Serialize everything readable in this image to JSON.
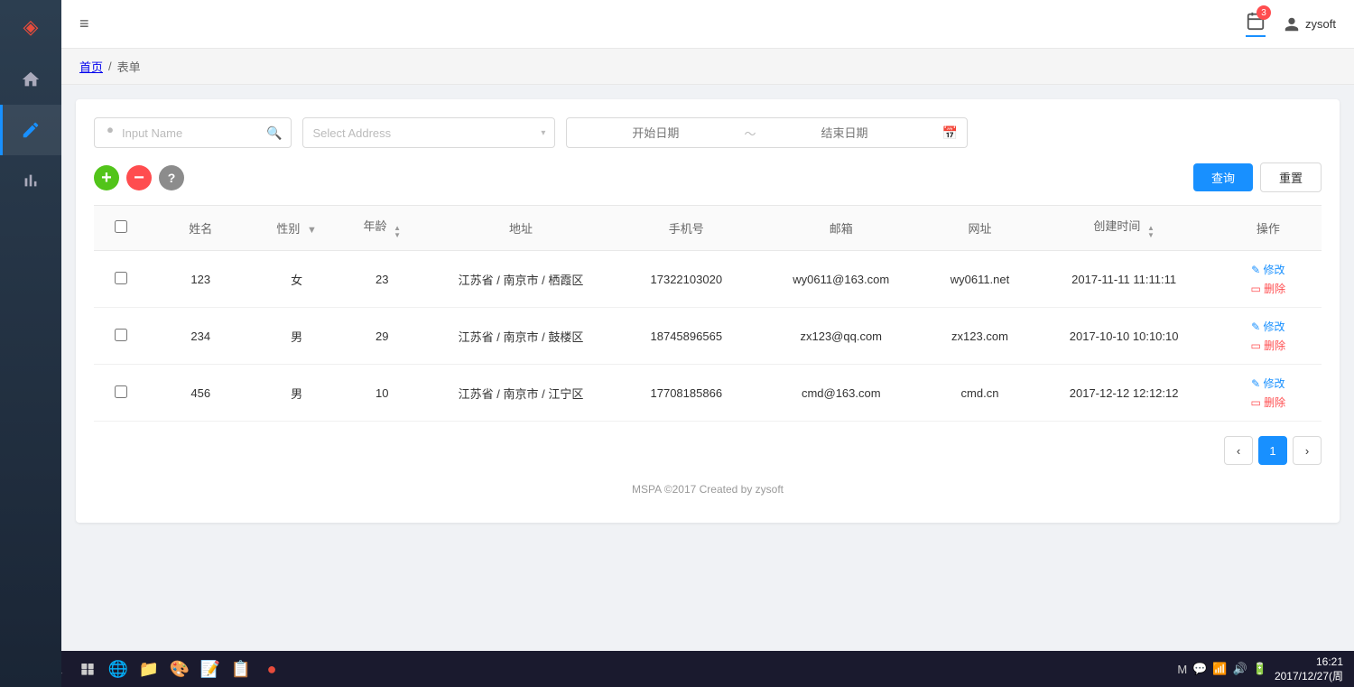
{
  "app": {
    "title": "MSPA",
    "logo": "◈",
    "footer": "MSPA ©2017 Created by zysoft"
  },
  "topbar": {
    "hamburger": "≡",
    "calendar_badge": "3",
    "username": "zysoft"
  },
  "breadcrumb": {
    "home": "首页",
    "separator": "/",
    "current": "表单"
  },
  "sidebar": {
    "items": [
      {
        "id": "home",
        "icon": "⌂",
        "label": "首页",
        "active": false
      },
      {
        "id": "edit",
        "icon": "✎",
        "label": "编辑",
        "active": true
      },
      {
        "id": "chart",
        "icon": "📊",
        "label": "图表",
        "active": false
      }
    ]
  },
  "filters": {
    "name_placeholder": "Input Name",
    "address_placeholder": "Select Address",
    "start_date_placeholder": "开始日期",
    "end_date_placeholder": "结束日期"
  },
  "buttons": {
    "add": "+",
    "delete": "−",
    "help": "?",
    "query": "查询",
    "reset": "重置"
  },
  "table": {
    "columns": [
      {
        "key": "check",
        "label": ""
      },
      {
        "key": "name",
        "label": "姓名"
      },
      {
        "key": "gender",
        "label": "性别",
        "filter": true
      },
      {
        "key": "age",
        "label": "年龄",
        "sort": true
      },
      {
        "key": "address",
        "label": "地址"
      },
      {
        "key": "phone",
        "label": "手机号"
      },
      {
        "key": "email",
        "label": "邮箱"
      },
      {
        "key": "url",
        "label": "网址"
      },
      {
        "key": "created",
        "label": "创建时间",
        "sort": true
      },
      {
        "key": "action",
        "label": "操作"
      }
    ],
    "rows": [
      {
        "id": 1,
        "name": "123",
        "gender": "女",
        "age": "23",
        "address": "江苏省 / 南京市 / 栖霞区",
        "phone": "17322103020",
        "email": "wy0611@163.com",
        "url": "wy0611.net",
        "created": "2017-11-11 11:11:11"
      },
      {
        "id": 2,
        "name": "234",
        "gender": "男",
        "age": "29",
        "address": "江苏省 / 南京市 / 鼓楼区",
        "phone": "18745896565",
        "email": "zx123@qq.com",
        "url": "zx123.com",
        "created": "2017-10-10 10:10:10"
      },
      {
        "id": 3,
        "name": "456",
        "gender": "男",
        "age": "10",
        "address": "江苏省 / 南京市 / 江宁区",
        "phone": "17708185866",
        "email": "cmd@163.com",
        "url": "cmd.cn",
        "created": "2017-12-12 12:12:12"
      }
    ],
    "op_edit": "修改",
    "op_delete": "删除"
  },
  "pagination": {
    "pages": [
      1
    ],
    "current": 1
  },
  "taskbar": {
    "time": "16:21",
    "date": "2017/12/27(周",
    "start_label": "⊞"
  }
}
